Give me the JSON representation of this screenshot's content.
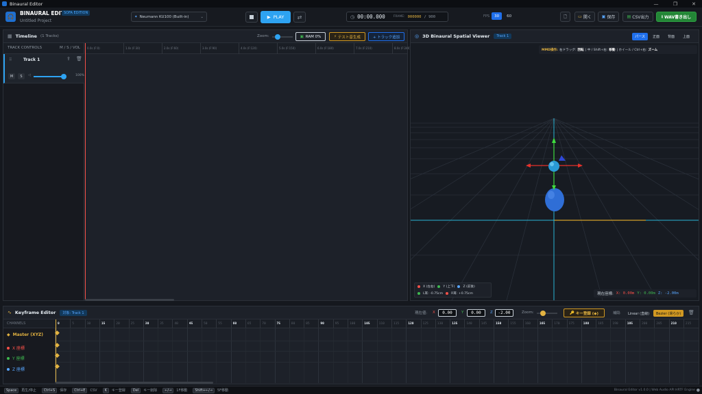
{
  "window": {
    "title": "Binaural Editor",
    "minimize": "—",
    "maximize": "❐",
    "close": "✕"
  },
  "header": {
    "app_name": "BINAURAL EDITOR",
    "badge": "SOFA EDITION",
    "project": "Untitled Project",
    "hrtf": "Neumann KU100 (Built-in)",
    "play_label": "PLAY",
    "time": "00:00.000",
    "frame_label": "FRAME:",
    "frame_current": "000000",
    "frame_total": "/ 900",
    "fps_label": "FPS",
    "fps_options": [
      "30",
      "60"
    ],
    "fps_selected": "30",
    "open_label": "開く",
    "save_label": "保存",
    "csv_label": "CSV出力",
    "wav_label": "WAV書き出し"
  },
  "timeline": {
    "title": "Timeline",
    "count": "(1 Tracks)",
    "zoom_label": "Zoom:",
    "ram_label": "RAM 0%",
    "test_label": "テスト音生成",
    "add_label": "+ トラック追加",
    "controls_header": "TRACK CONTROLS",
    "msv_header": "M / S / VOL",
    "ticks": [
      "0.0s (F:0)",
      "1.0s (F:30)",
      "2.0s (F:60)",
      "3.0s (F:90)",
      "4.0s (F:120)",
      "5.0s (F:150)",
      "6.0s (F:180)",
      "7.0s (F:210)",
      "8.0s (F:240)"
    ],
    "track": {
      "name": "Track 1",
      "mute": "M",
      "solo": "S",
      "volume_text": "100%",
      "volume": 1.0
    }
  },
  "viewer": {
    "title": "3D Binaural Spatial Viewer",
    "track_badge": "Track 1",
    "views": [
      "パース",
      "正面",
      "背面",
      "上面"
    ],
    "active_view": "パース",
    "help_prefix": "MMD操作:",
    "help_1": "右ドラッグ:",
    "help_1b": "回転",
    "help_2": "| 中 / Shift+右:",
    "help_2b": "移動",
    "help_3": "| ホイール / Ctrl+右:",
    "help_3b": "ズーム",
    "legend": {
      "x": "X (左右)",
      "y": "Y (上下)",
      "z": "Z (前後)",
      "l_ear": "L耳: -0.75cm",
      "r_ear": "R耳: +0.75cm"
    },
    "coord_label": "現在座標:",
    "coord_x": "X: 0.00m",
    "coord_y": "Y: 0.00m",
    "coord_z": "Z: -2.00m"
  },
  "keyframe": {
    "title": "Keyframe Editor",
    "target_badge": "対象: Track 1",
    "pos_label": "現在値:",
    "x_label": "X",
    "x_value": "0.00",
    "y_label": "Y",
    "y_value": "0.00",
    "z_label": "Z",
    "z_value": "-2.00",
    "zoom_label": "Zoom:",
    "key_button": "キー登録 (◆)",
    "interp_label": "補間:",
    "linear_label": "Linear (直線)",
    "bezier_label": "Bezier (滑らか)",
    "channels_header": "CHANNELS",
    "channels": [
      "Master (XYZ)",
      "X 座標",
      "Y 座標",
      "Z 座標"
    ],
    "frames": [
      "0",
      "5",
      "10",
      "15",
      "20",
      "25",
      "30",
      "35",
      "40",
      "45",
      "50",
      "55",
      "60",
      "65",
      "70",
      "75",
      "80",
      "85",
      "90",
      "95",
      "100",
      "105",
      "110",
      "115",
      "120",
      "125",
      "130",
      "135",
      "140",
      "145",
      "150",
      "155",
      "160",
      "165",
      "170",
      "175",
      "180",
      "185",
      "190",
      "195",
      "200",
      "205",
      "210",
      "215"
    ],
    "bold_frames": [
      "0",
      "15",
      "30",
      "45",
      "60",
      "75",
      "90",
      "105",
      "120",
      "135",
      "150",
      "165",
      "180",
      "195",
      "210"
    ]
  },
  "statusbar": {
    "items": [
      [
        "Space",
        "再生/停止"
      ],
      [
        "Ctrl+S",
        "保存"
      ],
      [
        "Ctrl+E",
        "CSV"
      ],
      [
        "K",
        "キー登録"
      ],
      [
        "Del",
        "キー削除"
      ],
      [
        "←/→",
        "1F移動"
      ],
      [
        "Shift+←/→",
        "5F移動"
      ]
    ],
    "right": "Binaural Editor v1.0.0 | Web Audio API HRTF Engine"
  },
  "colors": {
    "accent": "#1f6feb",
    "play": "#2ea3f2",
    "wav": "#238636",
    "playhead": "#f85149",
    "key_orange": "#d29922"
  }
}
